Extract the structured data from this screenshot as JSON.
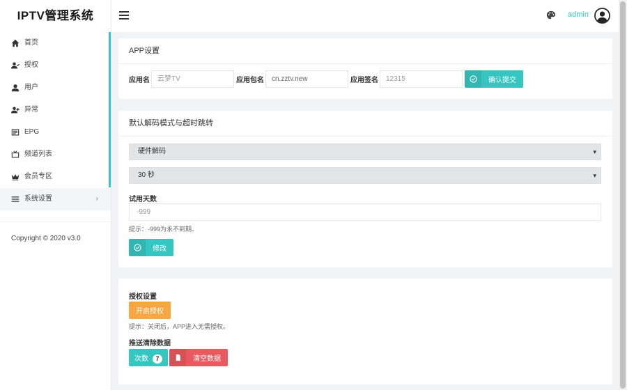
{
  "sidebar": {
    "brand": "IPTV管理系统",
    "items": [
      {
        "label": "首页",
        "icon": "home-icon"
      },
      {
        "label": "授权",
        "icon": "user-check-icon"
      },
      {
        "label": "用户",
        "icon": "user-icon"
      },
      {
        "label": "异常",
        "icon": "user-plus-icon"
      },
      {
        "label": "EPG",
        "icon": "epg-icon"
      },
      {
        "label": "频道列表",
        "icon": "tv-icon"
      },
      {
        "label": "会员专区",
        "icon": "crown-icon"
      },
      {
        "label": "系统设置",
        "icon": "menu-icon",
        "arrow": "›"
      }
    ],
    "copyright": "Copyright © 2020 v3.0"
  },
  "topbar": {
    "username": "admin"
  },
  "app_settings": {
    "title": "APP设置",
    "name_label": "应用名",
    "name_placeholder": "云梦TV",
    "package_label": "应用包名",
    "package_value": "cn.zztv.new",
    "sign_label": "应用签名",
    "sign_placeholder": "12315",
    "submit_label": "确认提交"
  },
  "decode_settings": {
    "title": "默认解码模式与超时跳转",
    "decode_mode": "硬件解码",
    "timeout": "30 秒",
    "trial_label": "试用天数",
    "trial_placeholder": "-999",
    "hint": "提示：-999为永不到期。",
    "modify_label": "修改"
  },
  "auth_settings": {
    "title": "授权设置",
    "enable_label": "开启授权",
    "hint": "提示：关闭后，APP进入无需授权。",
    "push_title": "推送清除数据",
    "count_label": "次数",
    "count_value": "7",
    "clear_label": "清空数据"
  },
  "colors": {
    "accent": "#36c6c1",
    "orange": "#f8a640",
    "red": "#e85a5f"
  }
}
